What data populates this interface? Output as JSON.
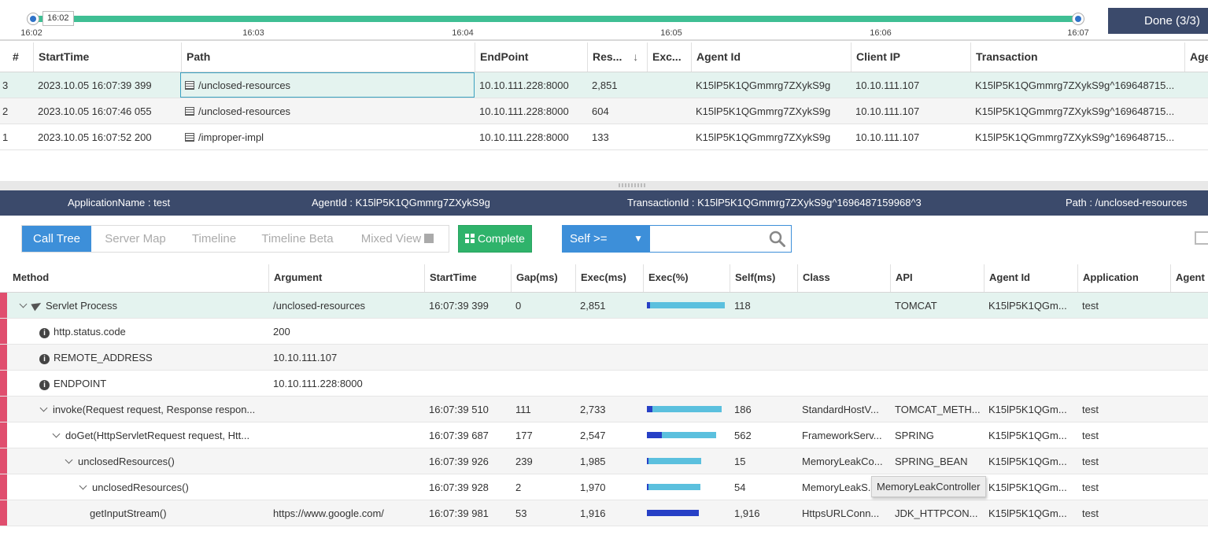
{
  "timeline": {
    "handle_label": "16:02",
    "ticks": [
      "16:02",
      "16:03",
      "16:04",
      "16:05",
      "16:06",
      "16:07"
    ],
    "done_label": "Done (3/3)"
  },
  "transactions": {
    "columns": [
      "#",
      "StartTime",
      "Path",
      "EndPoint",
      "Res...",
      "Exc...",
      "Agent Id",
      "Client IP",
      "Transaction",
      "Age"
    ],
    "sort_icon": "↓",
    "rows": [
      {
        "n": "3",
        "start": "2023.10.05 16:07:39 399",
        "path": "/unclosed-resources",
        "endpoint": "10.10.111.228:8000",
        "res": "2,851",
        "exc": "",
        "agent": "K15lP5K1QGmmrg7ZXykS9g",
        "ip": "10.10.111.107",
        "tx": "K15lP5K1QGmmrg7ZXykS9g^169648715..."
      },
      {
        "n": "2",
        "start": "2023.10.05 16:07:46 055",
        "path": "/unclosed-resources",
        "endpoint": "10.10.111.228:8000",
        "res": "604",
        "exc": "",
        "agent": "K15lP5K1QGmmrg7ZXykS9g",
        "ip": "10.10.111.107",
        "tx": "K15lP5K1QGmmrg7ZXykS9g^169648715..."
      },
      {
        "n": "1",
        "start": "2023.10.05 16:07:52 200",
        "path": "/improper-impl",
        "endpoint": "10.10.111.228:8000",
        "res": "133",
        "exc": "",
        "agent": "K15lP5K1QGmmrg7ZXykS9g",
        "ip": "10.10.111.107",
        "tx": "K15lP5K1QGmmrg7ZXykS9g^169648715..."
      }
    ]
  },
  "infobar": {
    "app": "ApplicationName : test",
    "agent": "AgentId : K15lP5K1QGmmrg7ZXykS9g",
    "tx": "TransactionId : K15lP5K1QGmmrg7ZXykS9g^1696487159968^3",
    "path": "Path : /unclosed-resources"
  },
  "toolbar": {
    "tabs": [
      "Call Tree",
      "Server Map",
      "Timeline",
      "Timeline Beta",
      "Mixed View"
    ],
    "complete_label": "Complete",
    "filter_label": "Self >=",
    "search_value": ""
  },
  "calltree": {
    "columns": [
      "Method",
      "Argument",
      "StartTime",
      "Gap(ms)",
      "Exec(ms)",
      "Exec(%)",
      "Self(ms)",
      "Class",
      "API",
      "Agent Id",
      "Application",
      "Agent"
    ],
    "rows": [
      {
        "method": "Servlet Process",
        "arg": "/unclosed-resources",
        "start": "16:07:39 399",
        "gap": "0",
        "exec": "2,851",
        "exec_pct": 100,
        "self_pct": 4,
        "self": "118",
        "class": "",
        "api": "TOMCAT",
        "agent": "K15lP5K1QGm...",
        "app": "test"
      },
      {
        "method": "http.status.code",
        "arg": "200",
        "start": "",
        "gap": "",
        "exec": "",
        "exec_pct": 0,
        "self_pct": 0,
        "self": "",
        "class": "",
        "api": "",
        "agent": "",
        "app": ""
      },
      {
        "method": "REMOTE_ADDRESS",
        "arg": "10.10.111.107",
        "start": "",
        "gap": "",
        "exec": "",
        "exec_pct": 0,
        "self_pct": 0,
        "self": "",
        "class": "",
        "api": "",
        "agent": "",
        "app": ""
      },
      {
        "method": "ENDPOINT",
        "arg": "10.10.111.228:8000",
        "start": "",
        "gap": "",
        "exec": "",
        "exec_pct": 0,
        "self_pct": 0,
        "self": "",
        "class": "",
        "api": "",
        "agent": "",
        "app": ""
      },
      {
        "method": "invoke(Request request, Response respon...",
        "arg": "",
        "start": "16:07:39 510",
        "gap": "111",
        "exec": "2,733",
        "exec_pct": 96,
        "self_pct": 7,
        "self": "186",
        "class": "StandardHostV...",
        "api": "TOMCAT_METH...",
        "agent": "K15lP5K1QGm...",
        "app": "test"
      },
      {
        "method": "doGet(HttpServletRequest request, Htt...",
        "arg": "",
        "start": "16:07:39 687",
        "gap": "177",
        "exec": "2,547",
        "exec_pct": 89,
        "self_pct": 22,
        "self": "562",
        "class": "FrameworkServ...",
        "api": "SPRING",
        "agent": "K15lP5K1QGm...",
        "app": "test"
      },
      {
        "method": "unclosedResources()",
        "arg": "",
        "start": "16:07:39 926",
        "gap": "239",
        "exec": "1,985",
        "exec_pct": 70,
        "self_pct": 1,
        "self": "15",
        "class": "MemoryLeakCo...",
        "api": "SPRING_BEAN",
        "agent": "K15lP5K1QGm...",
        "app": "test"
      },
      {
        "method": "unclosedResources()",
        "arg": "",
        "start": "16:07:39 928",
        "gap": "2",
        "exec": "1,970",
        "exec_pct": 69,
        "self_pct": 3,
        "self": "54",
        "class": "MemoryLeakS...",
        "api": "",
        "agent": "K15lP5K1QGm...",
        "app": "test"
      },
      {
        "method": "getInputStream()",
        "arg": "https://www.google.com/",
        "start": "16:07:39 981",
        "gap": "53",
        "exec": "1,916",
        "exec_pct": 67,
        "self_pct": 100,
        "self": "1,916",
        "class": "HttpsURLConn...",
        "api": "JDK_HTTPCON...",
        "agent": "K15lP5K1QGm...",
        "app": "test"
      }
    ],
    "tooltip": "MemoryLeakController"
  },
  "colors": {
    "accent": "#3d8fd9",
    "header": "#3b4a6b",
    "success": "#2fb36b",
    "track": "#3fbf94",
    "marker": "#e04e6e"
  }
}
